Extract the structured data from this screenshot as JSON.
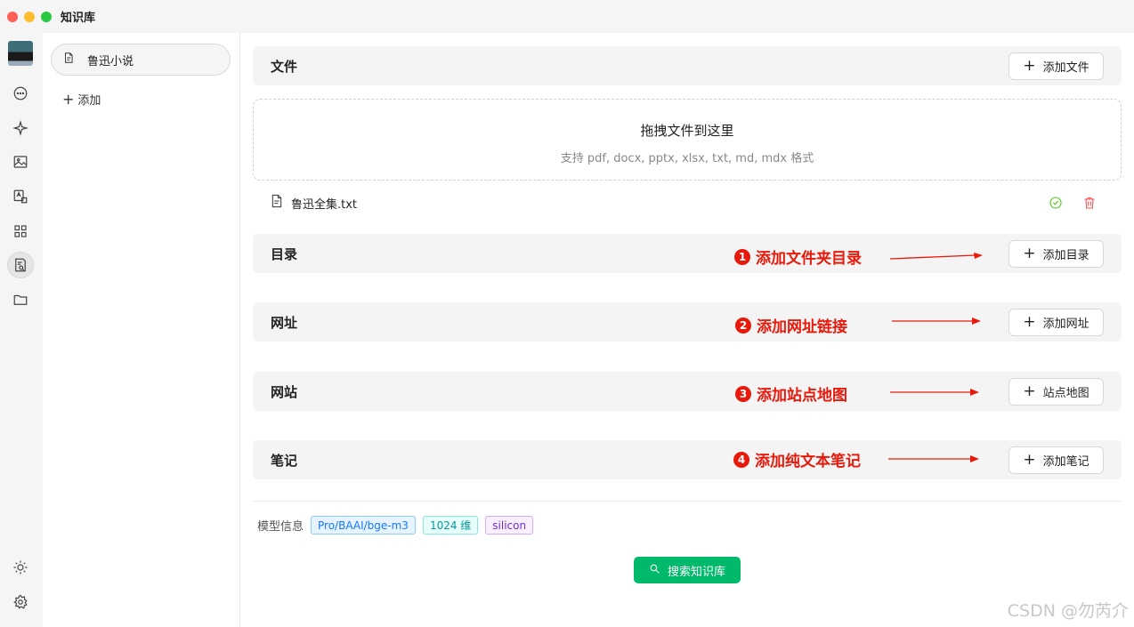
{
  "window": {
    "title": "知识库"
  },
  "sidebar": {
    "kb_item_label": "鲁迅小说",
    "add_label": "添加"
  },
  "sections": {
    "files": {
      "title": "文件",
      "button": "添加文件"
    },
    "directory": {
      "title": "目录",
      "button": "添加目录"
    },
    "url": {
      "title": "网址",
      "button": "添加网址"
    },
    "website": {
      "title": "网站",
      "button": "站点地图"
    },
    "note": {
      "title": "笔记",
      "button": "添加笔记"
    }
  },
  "dropzone": {
    "title": "拖拽文件到这里",
    "subtitle": "支持 pdf, docx, pptx, xlsx, txt, md, mdx 格式"
  },
  "file_list": [
    {
      "name": "鲁迅全集.txt",
      "status": "success"
    }
  ],
  "annotations": [
    {
      "num": "1",
      "text": "添加文件夹目录"
    },
    {
      "num": "2",
      "text": "添加网址链接"
    },
    {
      "num": "3",
      "text": "添加站点地图"
    },
    {
      "num": "4",
      "text": "添加纯文本笔记"
    }
  ],
  "model_info": {
    "label": "模型信息",
    "model": "Pro/BAAI/bge-m3",
    "dimensions": "1024 维",
    "provider": "silicon"
  },
  "search_button": "搜索知识库",
  "watermark": "CSDN @勿芮介",
  "colors": {
    "accent_green": "#00b96b",
    "annotation_red": "#e8190b",
    "success_green": "#52c41a",
    "delete_red": "#ff4d4f"
  }
}
